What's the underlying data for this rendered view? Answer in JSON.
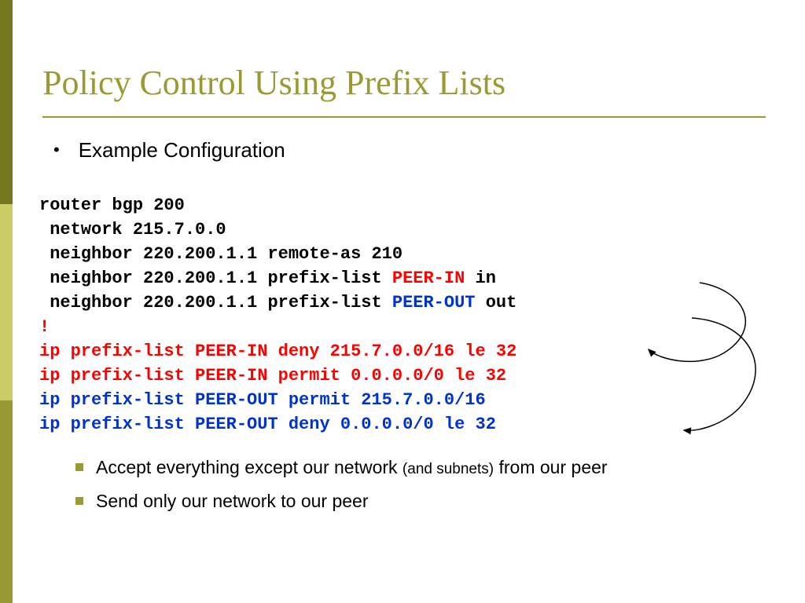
{
  "title": "Policy Control Using Prefix Lists",
  "bullet_top": "Example Configuration",
  "code": {
    "l1": "router bgp 200",
    "l2": " network 215.7.0.0",
    "l3": " neighbor 220.200.1.1 remote-as 210",
    "l4a": " neighbor 220.200.1.1 prefix-list ",
    "l4b": "PEER-IN",
    "l4c": " in",
    "l5a": " neighbor 220.200.1.1 prefix-list ",
    "l5b": "PEER-OUT",
    "l5c": " out",
    "l6": "!",
    "l7": "ip prefix-list PEER-IN deny 215.7.0.0/16 le 32",
    "l8": "ip prefix-list PEER-IN permit 0.0.0.0/0 le 32",
    "l9": "ip prefix-list PEER-OUT permit 215.7.0.0/16",
    "l10": "ip prefix-list PEER-OUT deny 0.0.0.0/0 le 32"
  },
  "notes": {
    "n1a": "Accept everything except our network ",
    "n1b": "(and subnets)",
    "n1c": " from our peer",
    "n2": "Send only our network to our peer"
  }
}
